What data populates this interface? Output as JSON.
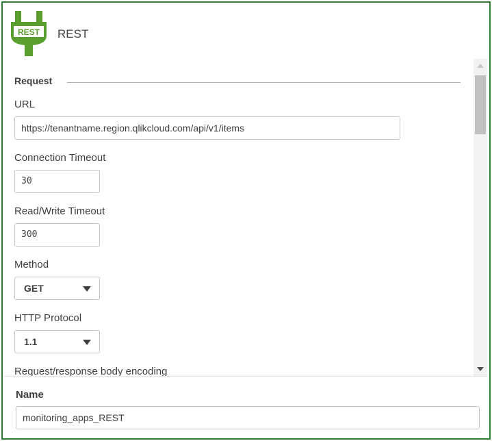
{
  "header": {
    "logo_text": "REST",
    "title": "REST",
    "logo_color": "#5a9e2f"
  },
  "request": {
    "section_title": "Request",
    "url_label": "URL",
    "url_value": "https://tenantname.region.qlikcloud.com/api/v1/items",
    "connection_timeout_label": "Connection Timeout",
    "connection_timeout_value": "30",
    "rw_timeout_label": "Read/Write Timeout",
    "rw_timeout_value": "300",
    "method_label": "Method",
    "method_value": "GET",
    "http_protocol_label": "HTTP Protocol",
    "http_protocol_value": "1.1",
    "encoding_label": "Request/response body encoding"
  },
  "footer": {
    "name_label": "Name",
    "name_value": "monitoring_apps_REST"
  },
  "colors": {
    "frame_border": "#2e7d32",
    "text": "#404040"
  }
}
